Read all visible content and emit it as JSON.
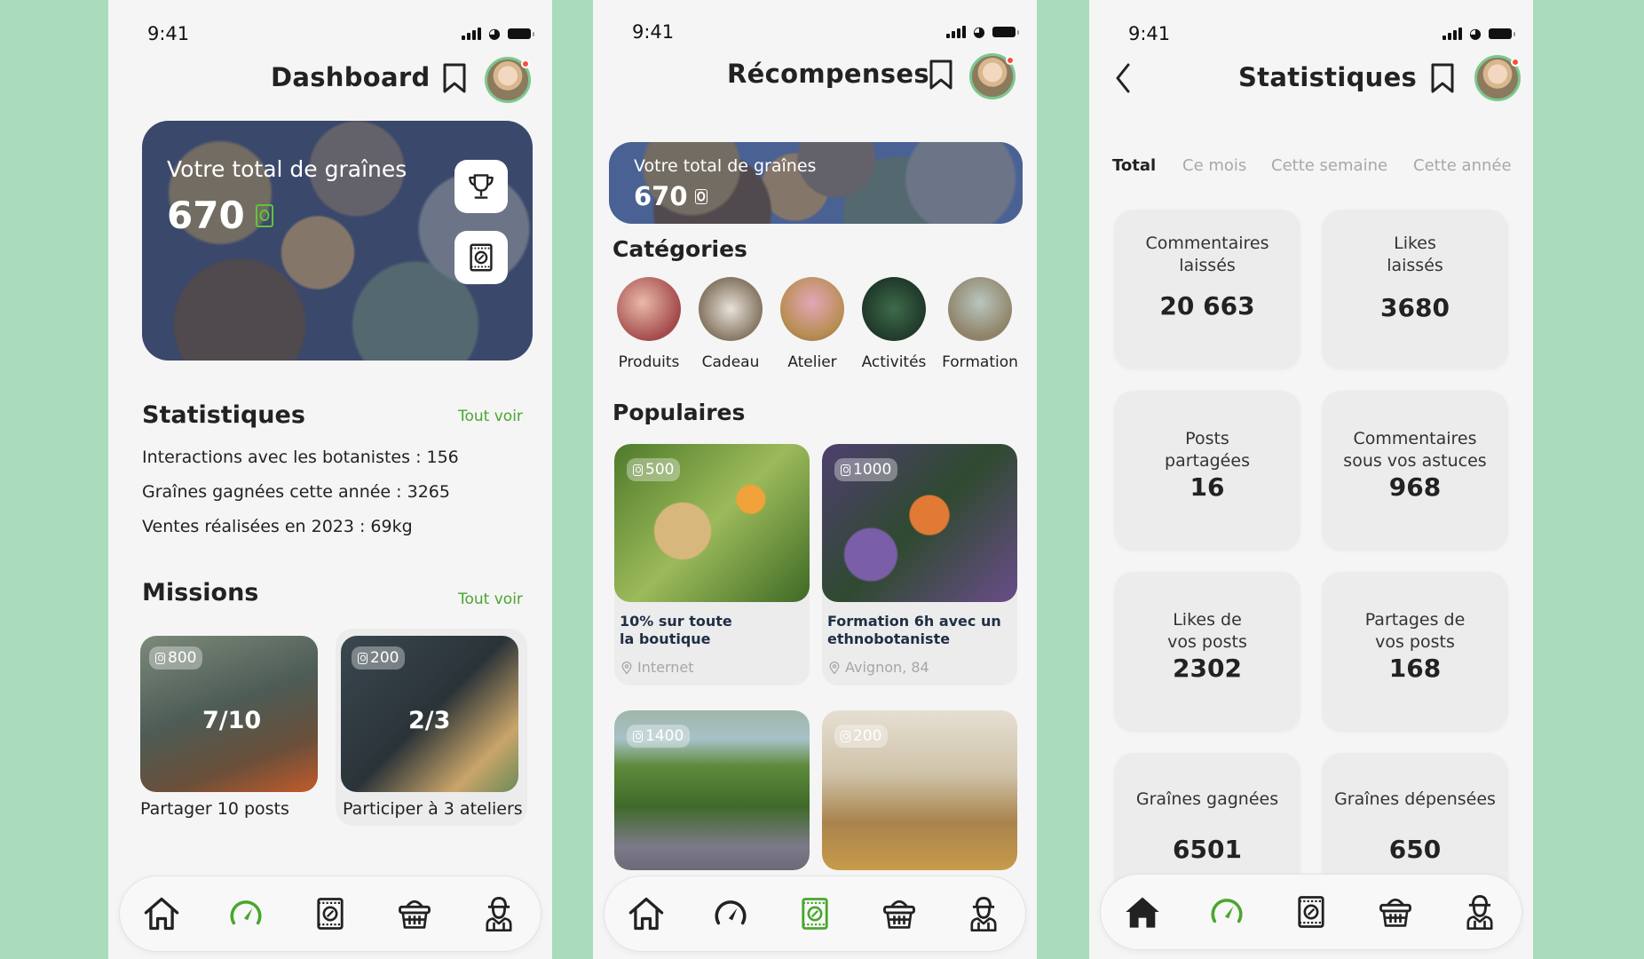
{
  "colors": {
    "background": "#a8dcbb",
    "accent": "#4aa62e",
    "card": "#ececec"
  },
  "status_bar": {
    "time": "9:41"
  },
  "dashboard": {
    "title": "Dashboard",
    "hero": {
      "label": "Votre total de graînes",
      "total": "670",
      "icons": [
        "trophy-icon",
        "seed-packet-icon"
      ]
    },
    "stats": {
      "title": "Statistiques",
      "see_all": "Tout voir",
      "lines": [
        "Interactions avec les botanistes  : 156",
        "Graînes gagnées cette année : 3265",
        "Ventes réalisées en 2023 : 69kg"
      ]
    },
    "missions": {
      "title": "Missions",
      "see_all": "Tout voir",
      "items": [
        {
          "badge": "800",
          "progress": "7/10",
          "caption": "Partager 10 posts"
        },
        {
          "badge": "200",
          "progress": "2/3",
          "caption": "Participer à 3 ateliers"
        }
      ]
    },
    "tabs": [
      {
        "icon": "home-icon",
        "active": false
      },
      {
        "icon": "gauge-icon",
        "active": true
      },
      {
        "icon": "seed-packet-icon",
        "active": false
      },
      {
        "icon": "basket-icon",
        "active": false
      },
      {
        "icon": "farmer-icon",
        "active": false
      }
    ]
  },
  "rewards": {
    "title": "Récompenses",
    "hero": {
      "label": "Votre total de graînes",
      "total": "670"
    },
    "categories_title": "Catégories",
    "categories": [
      "Produits",
      "Cadeau",
      "Atelier",
      "Activités",
      "Formation"
    ],
    "popular_title": "Populaires",
    "popular": [
      {
        "badge": "500",
        "title_line1": "10% sur toute",
        "title_line2": "la boutique",
        "location": "Internet"
      },
      {
        "badge": "1000",
        "title_line1": "Formation 6h avec un",
        "title_line2": "ethnobotaniste",
        "location": "Avignon, 84"
      },
      {
        "badge": "1400"
      },
      {
        "badge": "200"
      }
    ],
    "tabs": [
      {
        "icon": "home-icon",
        "active": false
      },
      {
        "icon": "gauge-icon",
        "active": false
      },
      {
        "icon": "seed-packet-icon",
        "active": true
      },
      {
        "icon": "basket-icon",
        "active": false
      },
      {
        "icon": "farmer-icon",
        "active": false
      }
    ]
  },
  "statistics": {
    "title": "Statistiques",
    "periods": [
      "Total",
      "Ce mois",
      "Cette semaine",
      "Cette année"
    ],
    "active_period": "Total",
    "cards": [
      {
        "label": "Commentaires\nlaissés",
        "value": "20 663"
      },
      {
        "label": "Likes\nlaissés",
        "value": "3680"
      },
      {
        "label": "Posts\npartagées",
        "value": "16"
      },
      {
        "label": "Commentaires\nsous vos astuces",
        "value": "968"
      },
      {
        "label": "Likes de\nvos posts",
        "value": "2302"
      },
      {
        "label": "Partages de\nvos posts",
        "value": "168"
      },
      {
        "label": "Graînes gagnées",
        "value": "6501"
      },
      {
        "label": "Graînes dépensées",
        "value": "650"
      }
    ],
    "tabs": [
      {
        "icon": "home-icon",
        "active": true
      },
      {
        "icon": "gauge-icon",
        "active": false
      },
      {
        "icon": "seed-packet-icon",
        "active": false
      },
      {
        "icon": "basket-icon",
        "active": false
      },
      {
        "icon": "farmer-icon",
        "active": false
      }
    ]
  }
}
